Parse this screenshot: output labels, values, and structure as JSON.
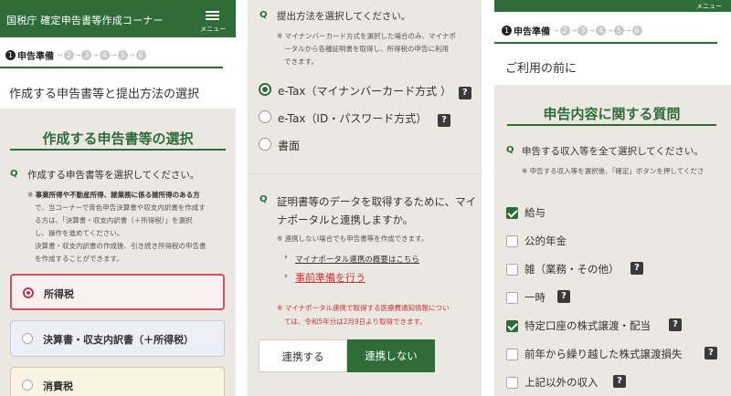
{
  "panel1": {
    "header_title": "国税庁 確定申告書等作成コーナー",
    "menu_label": "メニュー",
    "steps": {
      "current_num": "1",
      "current_label": "申告準備",
      "others": [
        "2",
        "3",
        "4",
        "5",
        "6"
      ]
    },
    "page_heading": "作成する申告書等と提出方法の選択",
    "section_title": "作成する申告書等の選択",
    "question_mark": "Q",
    "question": "作成する申告書等を選択してください。",
    "note_line1_prefix": "※ ",
    "note_line1_bold": "事業所得や不動産所得、雑業務に係る雑所得のある方",
    "note_lines": [
      "で、当コーナーで青色申告決算書や収支内訳書を作成す",
      "る方は、「決算書・収支内訳書（＋所得税）」を選択",
      "し、操作を進めてください。",
      "決算書・収支内訳書の作成後、引き続き所得税の申告書",
      "を作成することができます。"
    ],
    "options": [
      "所得税",
      "決算書・収支内訳書（＋所得税）",
      "消費税"
    ],
    "selected_option": "所得税"
  },
  "panel2": {
    "question_mark": "Q",
    "question1": "提出方法を選択してください。",
    "note1": [
      "※ マイナンバーカード方式を選択した場合のみ、マイナポ",
      "ータルから各種証明書を取得し、所得税の申告に利用",
      "できます。"
    ],
    "methods": [
      "e-Tax（マイナンバーカード方式 ）",
      "e-Tax（ID・パスワード方式）",
      "書面"
    ],
    "selected_method": "e-Tax（マイナンバーカード方式 ）",
    "help_glyph": "?",
    "question2_lines": [
      "証明書等のデータを取得するために、マイ",
      "ナポータルと連携しますか。"
    ],
    "note2": "※ 連携しない場合でも申告書等を作成できます。",
    "link1": "マイナポータル連携の概要はこちら",
    "link2": "事前準備を行う",
    "red_note": [
      "※ マイナポータル連携で取得する医療費通知情報につい",
      "ては、令和5年分は2月9日より取得できます。"
    ],
    "btn_link": "連携する",
    "btn_nolink": "連携しない"
  },
  "panel3": {
    "menu_label": "メニュー",
    "steps": {
      "current_num": "1",
      "current_label": "申告準備",
      "others": [
        "2",
        "3",
        "4",
        "5",
        "6"
      ]
    },
    "page_heading": "ご利用の前に",
    "section_title": "申告内容に関する質問",
    "question_mark": "Q",
    "question": "申告する収入等を全て選択してください。",
    "note": "※ 申告する収入等を選択後、「確定」ボタンを押してくださ",
    "help_glyph": "?",
    "items": [
      {
        "label": "給与",
        "checked": true,
        "help": false
      },
      {
        "label": "公的年金",
        "checked": false,
        "help": false
      },
      {
        "label": "雑（業務・その他）",
        "checked": false,
        "help": true
      },
      {
        "label": "一時",
        "checked": false,
        "help": true
      },
      {
        "label": "特定口座の株式譲渡・配当",
        "checked": true,
        "help": true
      },
      {
        "label": "前年から繰り越した株式譲渡損失",
        "checked": false,
        "help": true
      },
      {
        "label": "上記以外の収入",
        "checked": false,
        "help": true
      }
    ]
  },
  "colors": {
    "brand_green": "#2e6d3a",
    "accent_red": "#c3324b",
    "panel_bg": "#eae8e1"
  }
}
